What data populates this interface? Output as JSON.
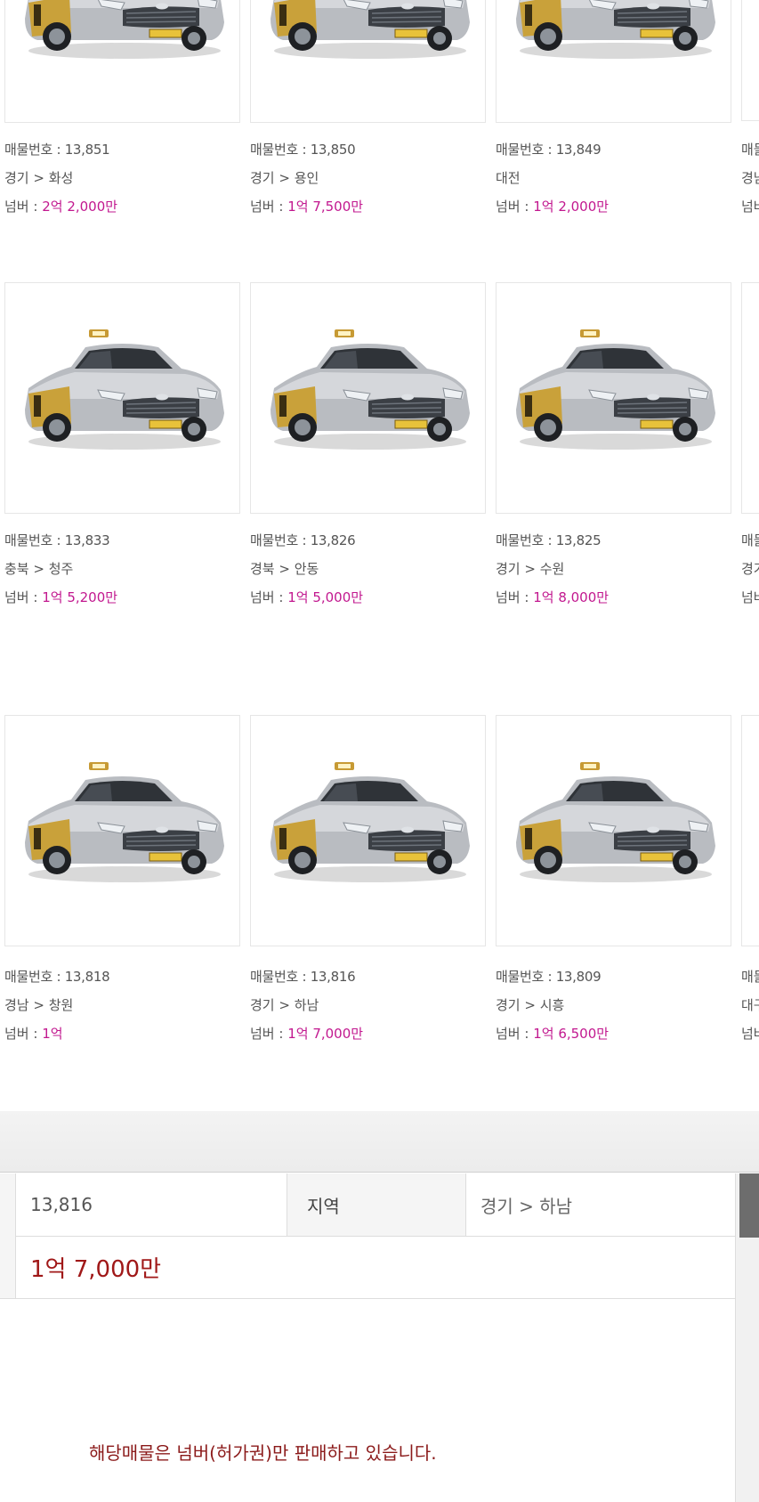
{
  "listings": [
    {
      "num_label": "매물번호 : 13,851",
      "region": "경기 > 화성",
      "price_label": "넘버 : ",
      "price": "2억 2,000만"
    },
    {
      "num_label": "매물번호 : 13,850",
      "region": "경기 > 용인",
      "price_label": "넘버 : ",
      "price": "1억 7,500만"
    },
    {
      "num_label": "매물번호 : 13,849",
      "region": "대전",
      "price_label": "넘버 : ",
      "price": "1억 2,000만"
    },
    {
      "num_label": "매물번호 : 13,833",
      "region": "충북 > 청주",
      "price_label": "넘버 : ",
      "price": "1억 5,200만"
    },
    {
      "num_label": "매물번호 : 13,826",
      "region": "경북 > 안동",
      "price_label": "넘버 : ",
      "price": "1억 5,000만"
    },
    {
      "num_label": "매물번호 : 13,825",
      "region": "경기 > 수원",
      "price_label": "넘버 : ",
      "price": "1억 8,000만"
    },
    {
      "num_label": "매물번호 : 13,818",
      "region": "경남 > 창원",
      "price_label": "넘버 : ",
      "price": "1억"
    },
    {
      "num_label": "매물번호 : 13,816",
      "region": "경기 > 하남",
      "price_label": "넘버 : ",
      "price": "1억 7,000만"
    },
    {
      "num_label": "매물번호 : 13,809",
      "region": "경기 > 시흥",
      "price_label": "넘버 : ",
      "price": "1억 6,500만"
    }
  ],
  "partial_column": [
    {
      "num_label": "매물",
      "region": "경남",
      "price_label": "넘버"
    },
    {
      "num_label": "매물",
      "region": "경기",
      "price_label": "넘버"
    },
    {
      "num_label": "매물",
      "region": "대구",
      "price_label": "넘버"
    }
  ],
  "detail": {
    "number": "13,816",
    "region_label": "지역",
    "region": "경기 > 하남",
    "price": "1억 7,000만"
  },
  "notice": "해당매물은 넘버(허가권)만 판매하고 있습니다.",
  "colors": {
    "price_accent": "#c2188f",
    "detail_price": "#a01818",
    "notice_text": "#8b1a1a"
  },
  "icons": [
    "taxi-car-image"
  ]
}
